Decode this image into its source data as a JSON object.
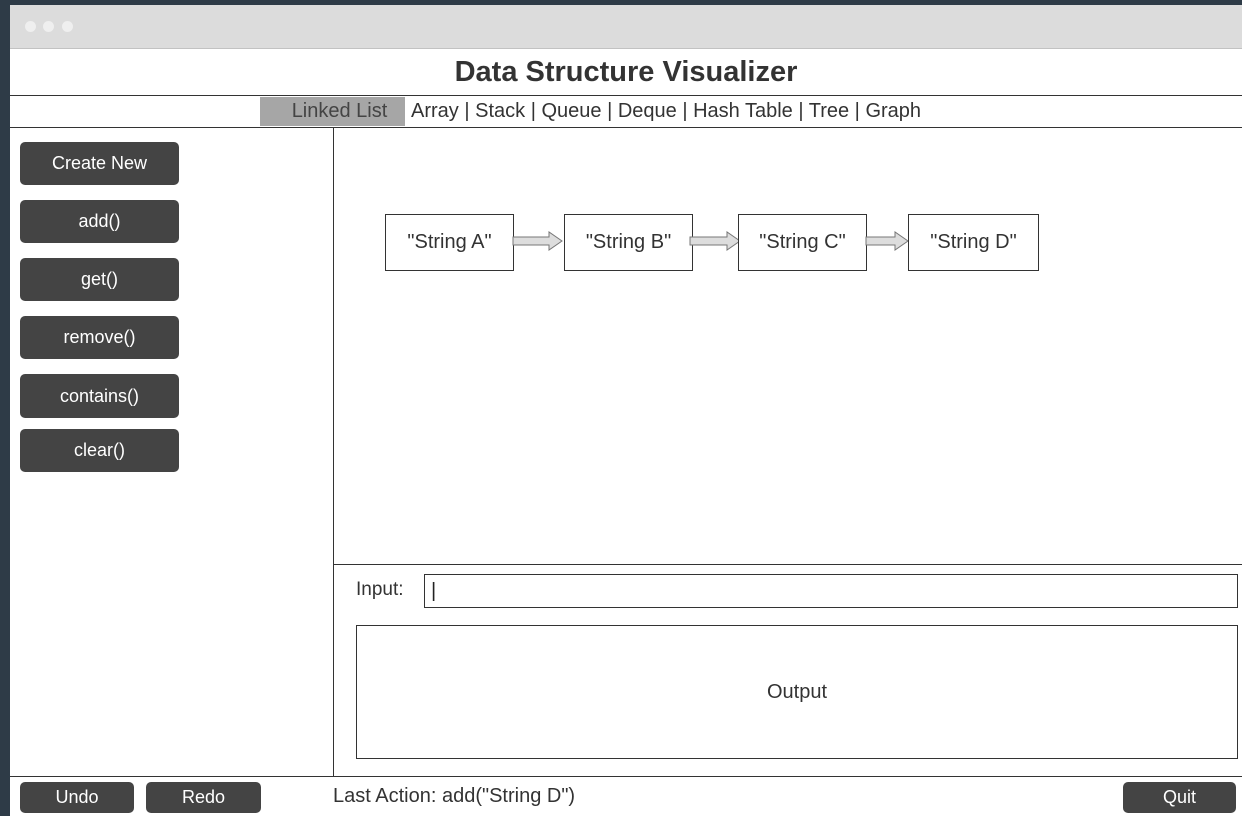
{
  "app": {
    "title": "Data Structure Visualizer"
  },
  "tabs": {
    "active": "Linked List",
    "items": [
      "Array",
      "Stack",
      "Queue",
      "Deque",
      "Hash Table",
      "Tree",
      "Graph"
    ],
    "separator": " | "
  },
  "sidebar": {
    "buttons": [
      "Create New",
      "add()",
      "get()",
      "remove()",
      "contains()",
      "clear()"
    ]
  },
  "linked_list": {
    "nodes": [
      "\"String A\"",
      "\"String B\"",
      "\"String C\"",
      "\"String D\""
    ]
  },
  "io": {
    "input_label": "Input:",
    "input_value": "|",
    "output_label": "Output"
  },
  "footer": {
    "undo_label": "Undo",
    "redo_label": "Redo",
    "last_action": "Last Action: add(\"String D\")",
    "quit_label": "Quit"
  },
  "colors": {
    "button_bg": "#444444",
    "active_tab_bg": "#a6a6a6",
    "titlebar_bg": "#dcdcdc",
    "desktop_bg": "#2e3b47"
  },
  "icons": {
    "window_controls": "traffic-light-dots",
    "node_link": "right-arrow-icon"
  }
}
